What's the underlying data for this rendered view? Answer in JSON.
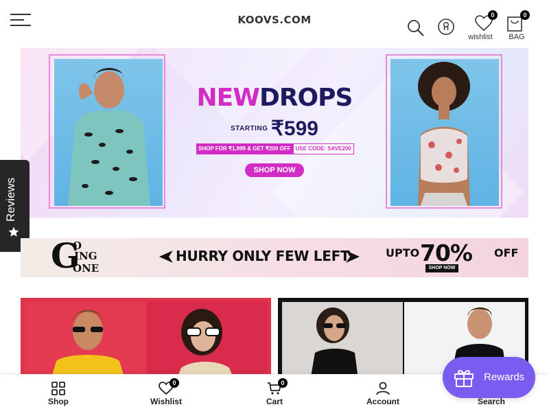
{
  "header": {
    "logo": "KOOVS.COM",
    "wishlist_label": "wishlist",
    "wishlist_count": "0",
    "bag_label": "BAG",
    "bag_count": "0"
  },
  "hero": {
    "title_part1": "NEW",
    "title_part2": "DROPS",
    "starting_label": "STARTING",
    "price": "₹599",
    "offer_text": "SHOP FOR ₹1,999 & GET ₹200 OFF",
    "code_text": "USE CODE: SAVE200",
    "cta": "SHOP NOW"
  },
  "reviews_tab": {
    "label": "Reviews"
  },
  "promo": {
    "going_g": "G",
    "going_o": "O",
    "going_ing": "ING",
    "going_one": "ONE",
    "hurry": "HURRY ONLY FEW LEFT",
    "upto": "UPTO",
    "discount": "70%",
    "off": "OFF",
    "cta": "SHOP NOW"
  },
  "bottom_nav": {
    "items": [
      {
        "label": "Shop",
        "icon": "grid-icon"
      },
      {
        "label": "Wishlist",
        "icon": "heart-icon",
        "badge": "0"
      },
      {
        "label": "Cart",
        "icon": "cart-icon",
        "badge": "0"
      },
      {
        "label": "Account",
        "icon": "user-icon"
      },
      {
        "label": "Search",
        "icon": "search-icon"
      }
    ]
  },
  "rewards": {
    "label": "Rewards",
    "icon": "gift-icon"
  },
  "colors": {
    "accent_pink": "#d12dc4",
    "navy": "#1d1a5e",
    "rewards_purple": "#7b5cf0",
    "tile_red": "#e0324b"
  }
}
